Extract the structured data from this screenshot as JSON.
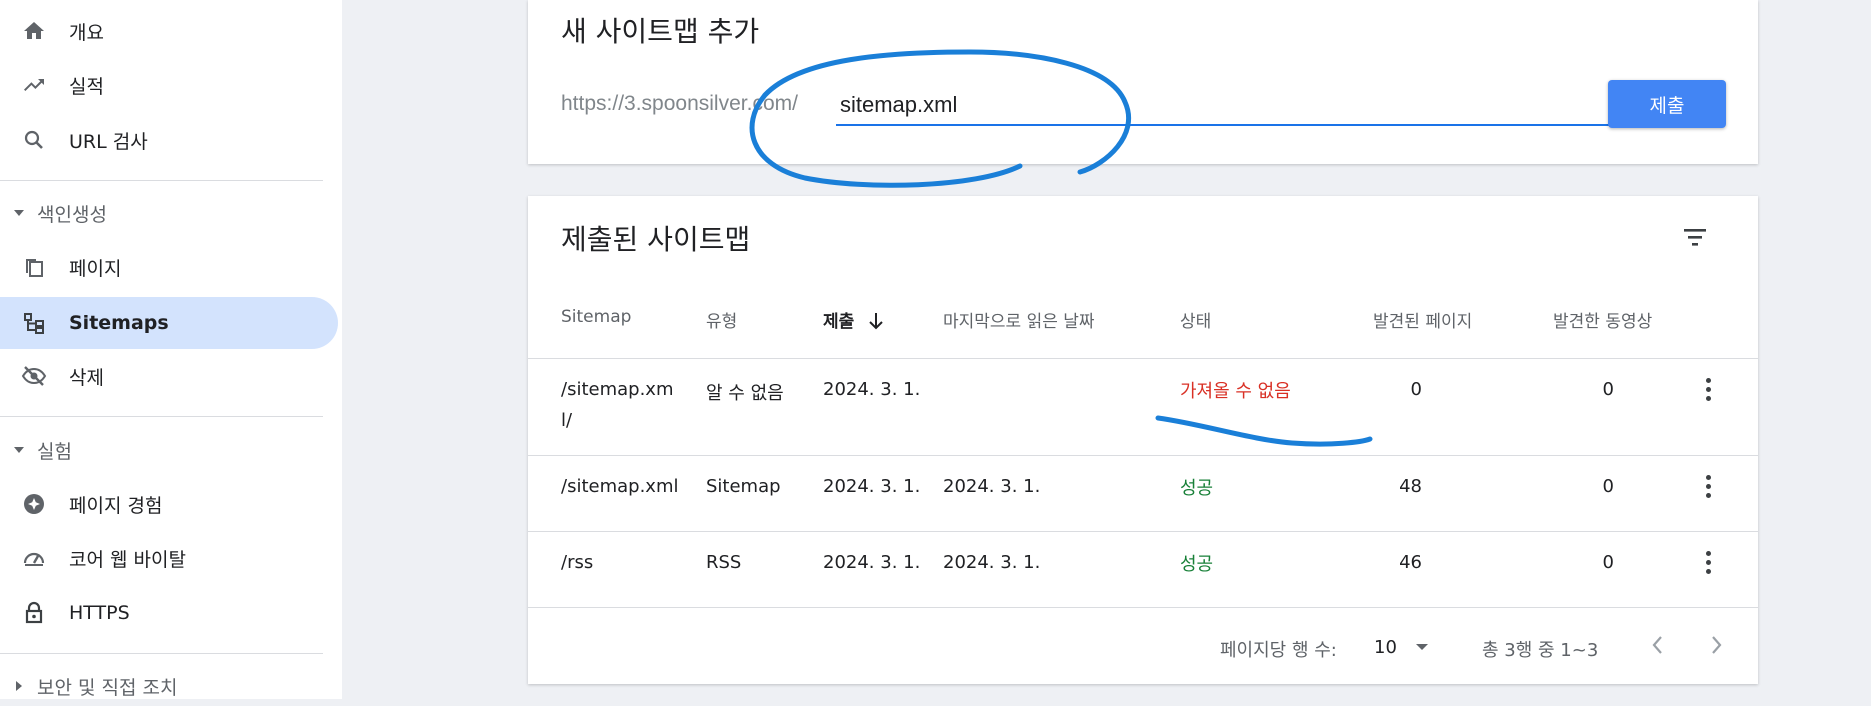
{
  "sidebar": {
    "items": [
      {
        "label": "개요",
        "icon": "home-icon"
      },
      {
        "label": "실적",
        "icon": "trending-up-icon"
      },
      {
        "label": "URL 검사",
        "icon": "search-icon"
      },
      {
        "label": "페이지",
        "icon": "pages-icon"
      },
      {
        "label": "Sitemaps",
        "icon": "sitemap-icon",
        "active": true
      },
      {
        "label": "삭제",
        "icon": "visibility-off-icon"
      },
      {
        "label": "페이지 경험",
        "icon": "star-circle-icon"
      },
      {
        "label": "코어 웹 바이탈",
        "icon": "speed-gauge-icon"
      },
      {
        "label": "HTTPS",
        "icon": "lock-icon"
      }
    ],
    "sections": [
      {
        "label": "색인생성"
      },
      {
        "label": "실험"
      },
      {
        "label": "보안 및 직접 조치"
      }
    ]
  },
  "add_sitemap": {
    "title": "새 사이트맵 추가",
    "url_prefix": "https://3.spoonsilver.com/",
    "input_value": "sitemap.xml",
    "submit_label": "제출"
  },
  "submitted": {
    "title": "제출된 사이트맵",
    "columns": [
      "Sitemap",
      "유형",
      "제출",
      "마지막으로 읽은 날짜",
      "상태",
      "발견된 페이지",
      "발견한 동영상"
    ],
    "rows": [
      {
        "sitemap_l1": "/sitemap.xm",
        "sitemap_l2": "l/",
        "type": "알 수 없음",
        "submitted": "2024. 3. 1.",
        "last_read": "",
        "status": "가져올 수 없음",
        "status_kind": "fail",
        "pages": "0",
        "videos": "0"
      },
      {
        "sitemap_l1": "/sitemap.xml",
        "sitemap_l2": "",
        "type": "Sitemap",
        "submitted": "2024. 3. 1.",
        "last_read": "2024. 3. 1.",
        "status": "성공",
        "status_kind": "ok",
        "pages": "48",
        "videos": "0"
      },
      {
        "sitemap_l1": "/rss",
        "sitemap_l2": "",
        "type": "RSS",
        "submitted": "2024. 3. 1.",
        "last_read": "2024. 3. 1.",
        "status": "성공",
        "status_kind": "ok",
        "pages": "46",
        "videos": "0"
      }
    ],
    "pager": {
      "rows_per_page_label": "페이지당 행 수:",
      "rows_per_page_value": "10",
      "range_text": "총 3행 중 1~3"
    }
  },
  "colors": {
    "accent": "#4285f4",
    "active_nav": "#d3e3fd",
    "fail": "#d93025",
    "ok": "#188038",
    "annotation": "#1a7fd8"
  }
}
